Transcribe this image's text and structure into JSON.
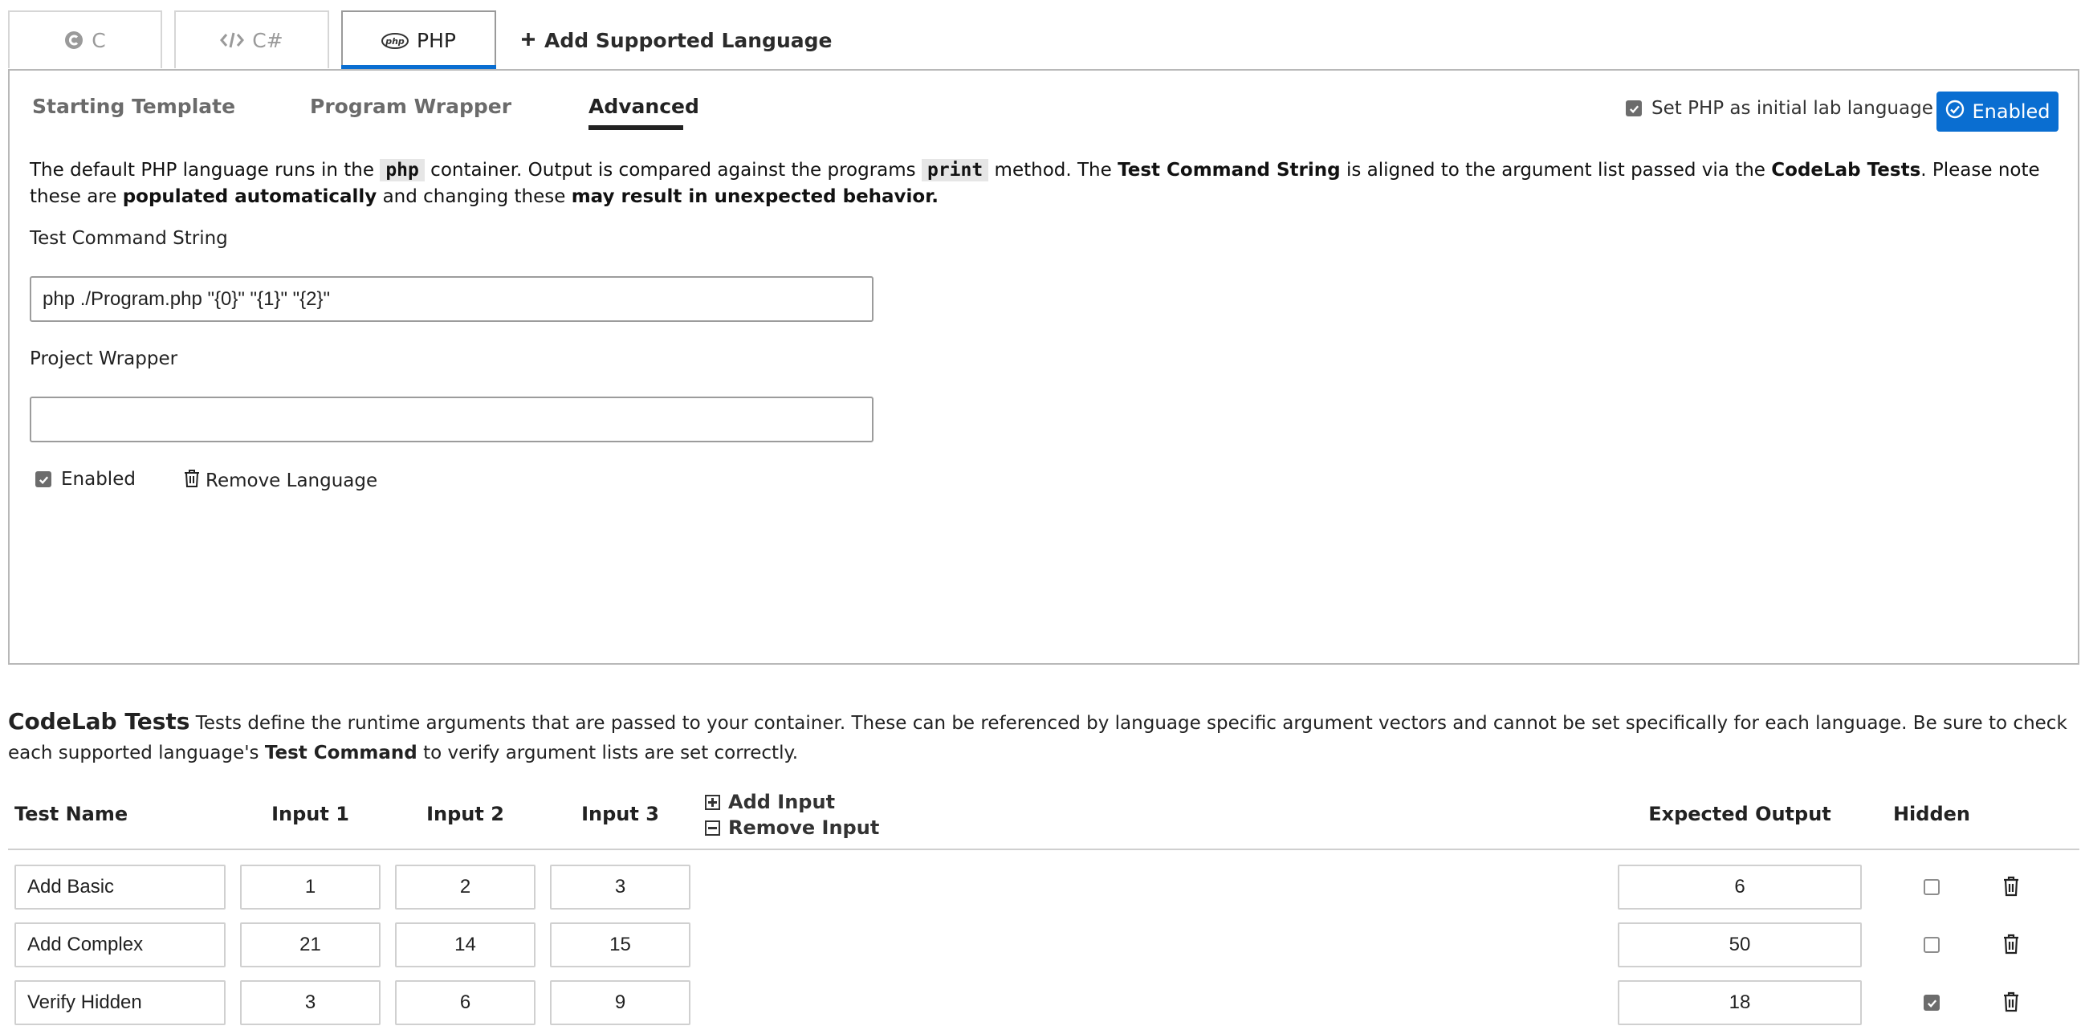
{
  "language_tabs": [
    {
      "label": "C",
      "icon": "c-logo-icon",
      "active": false
    },
    {
      "label": "C#",
      "icon": "code-icon",
      "active": false
    },
    {
      "label": "PHP",
      "icon": "php-logo-icon",
      "active": true
    }
  ],
  "add_language_label": "Add Supported Language",
  "php_logo_text": "php",
  "subtabs": [
    {
      "label": "Starting Template",
      "active": false
    },
    {
      "label": "Program Wrapper",
      "active": false
    },
    {
      "label": "Advanced",
      "active": true
    }
  ],
  "initial_language": {
    "label": "Set PHP as initial lab language",
    "checked": true
  },
  "enabled_button_label": "Enabled",
  "description": {
    "p1": "The default PHP language runs in the",
    "code1": "php",
    "p2": "container. Output is compared against the programs",
    "code2": "print",
    "p3": "method. The",
    "b1": "Test Command String",
    "p4": "is aligned to the argument list passed via the",
    "b2": "CodeLab Tests",
    "p5": ". Please note these are",
    "b3": "populated automatically",
    "p6": "and changing these",
    "b4": "may result in unexpected behavior."
  },
  "test_command": {
    "label": "Test Command String",
    "value": "php ./Program.php \"{0}\" \"{1}\" \"{2}\""
  },
  "project_wrapper": {
    "label": "Project Wrapper",
    "value": ""
  },
  "enabled_checkbox": {
    "label": "Enabled",
    "checked": true
  },
  "remove_language_label": "Remove Language",
  "codelab": {
    "title": "CodeLab Tests",
    "desc1": "Tests define the runtime arguments that are passed to your container. These can be referenced by language specific argument vectors and cannot be set specifically for each language. Be sure to check each supported language's",
    "desc_bold": "Test Command",
    "desc2": "to verify argument lists are set correctly."
  },
  "table": {
    "headers": {
      "test_name": "Test Name",
      "input1": "Input 1",
      "input2": "Input 2",
      "input3": "Input 3",
      "expected_output": "Expected Output",
      "hidden": "Hidden"
    },
    "add_input_label": "Add Input",
    "remove_input_label": "Remove Input",
    "rows": [
      {
        "name": "Add Basic",
        "input1": "1",
        "input2": "2",
        "input3": "3",
        "expected": "6",
        "hidden": false
      },
      {
        "name": "Add Complex",
        "input1": "21",
        "input2": "14",
        "input3": "15",
        "expected": "50",
        "hidden": false
      },
      {
        "name": "Verify Hidden",
        "input1": "3",
        "input2": "6",
        "input3": "9",
        "expected": "18",
        "hidden": true
      }
    ]
  },
  "colors": {
    "accent": "#0a6ed1",
    "checkbox": "#6c6c6c"
  }
}
